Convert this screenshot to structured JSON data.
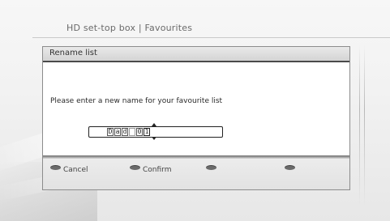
{
  "header": {
    "title": "HD set-top box | Favourites"
  },
  "dialog": {
    "title": "Rename list",
    "prompt": "Please enter a new name for your favourite list",
    "name_chars": [
      "D",
      "a",
      "d",
      " ",
      "0",
      "1"
    ]
  },
  "footer": {
    "keys": [
      {
        "label": "Cancel"
      },
      {
        "label": "Confirm"
      },
      {
        "label": ""
      },
      {
        "label": ""
      }
    ]
  }
}
